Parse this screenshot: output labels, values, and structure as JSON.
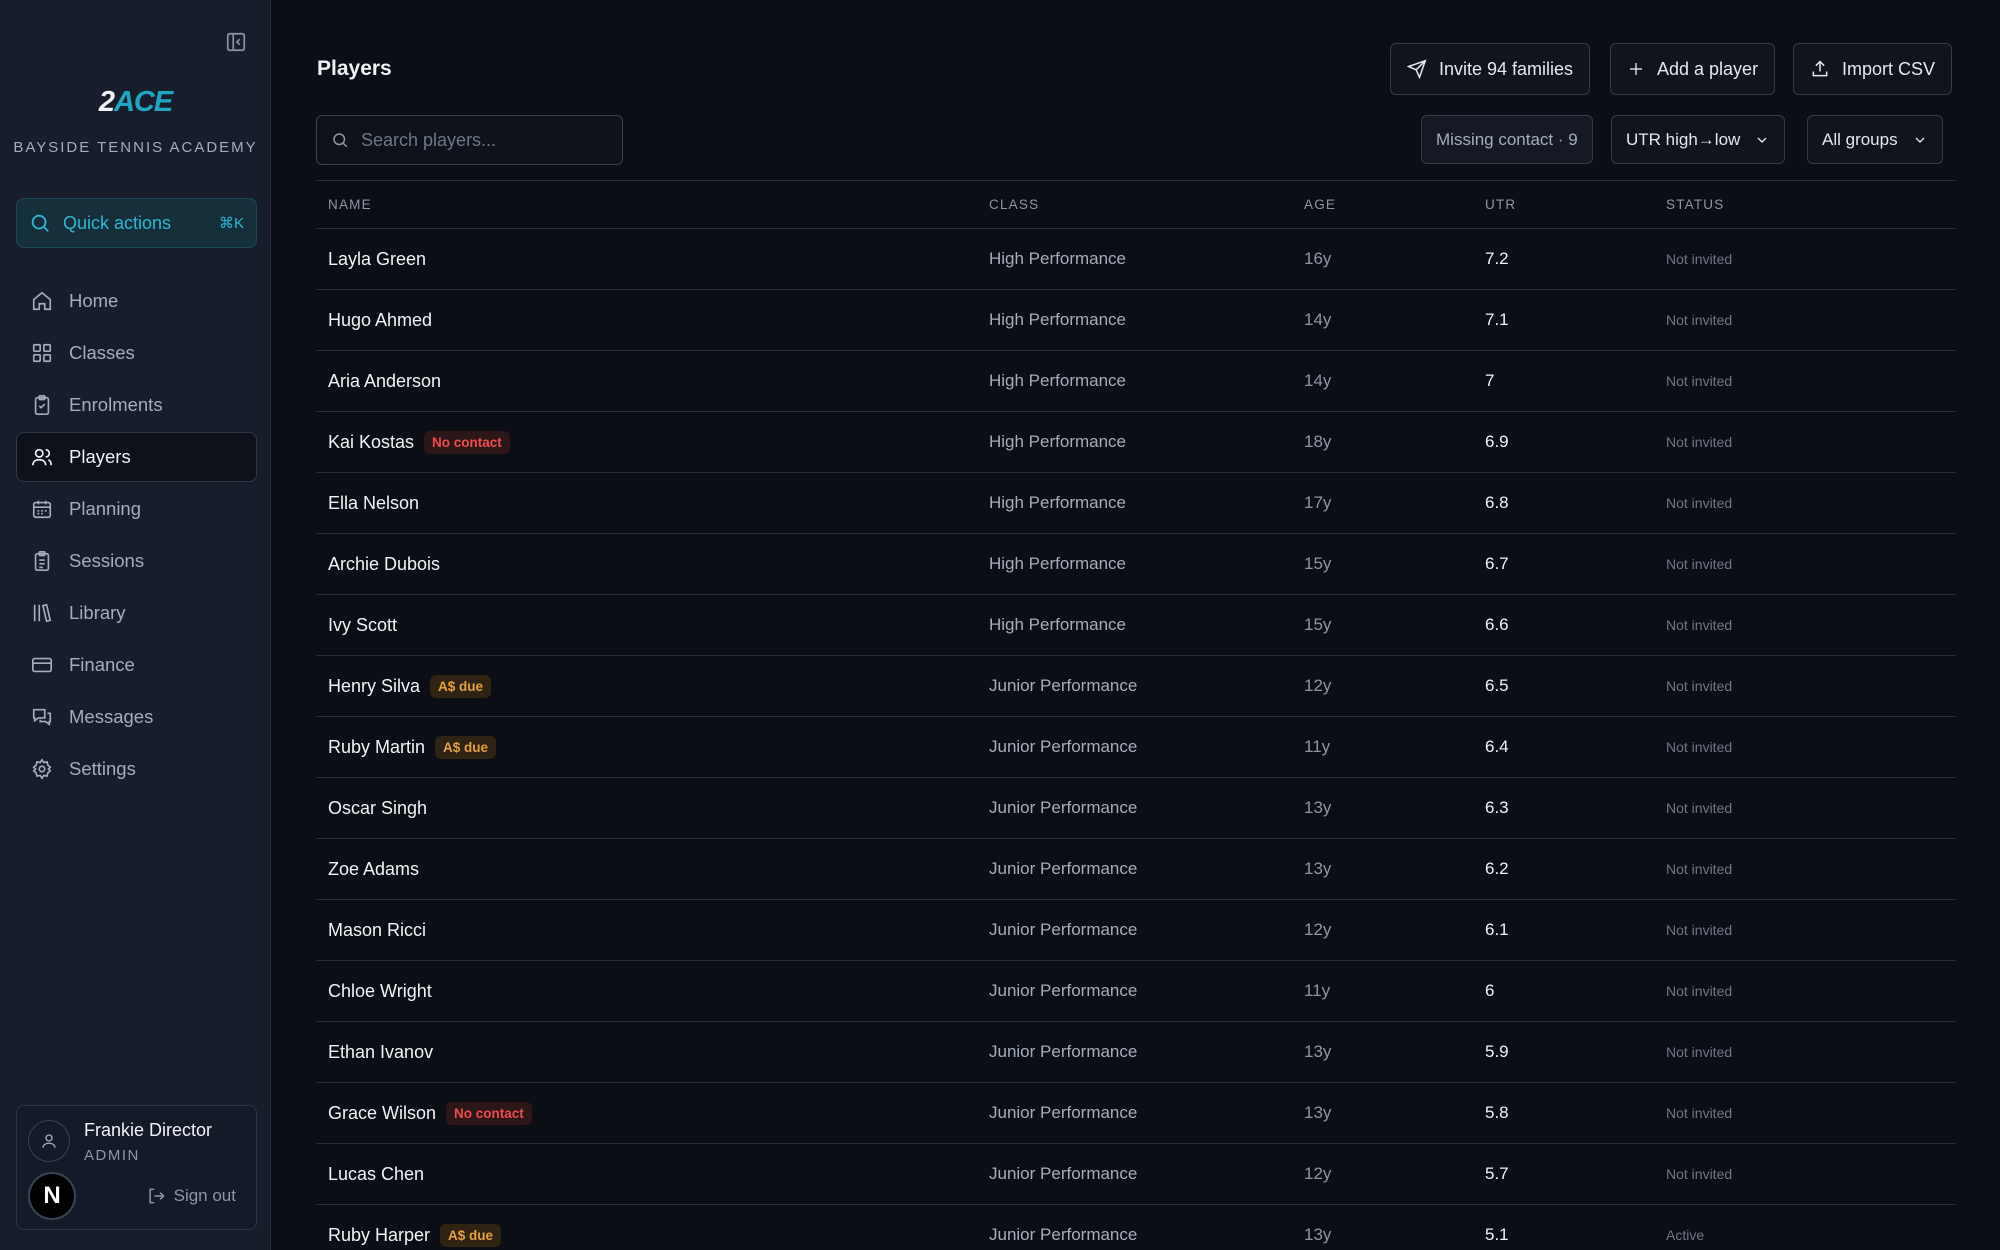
{
  "sidebar": {
    "logo_prefix": "2",
    "logo_suffix": "ACE",
    "academy": "BAYSIDE TENNIS ACADEMY",
    "quick_actions": {
      "label": "Quick actions",
      "shortcut": "⌘K"
    },
    "items": [
      {
        "label": "Home",
        "icon": "home-icon"
      },
      {
        "label": "Classes",
        "icon": "grid-icon"
      },
      {
        "label": "Enrolments",
        "icon": "clipboard-check-icon"
      },
      {
        "label": "Players",
        "icon": "users-icon",
        "active": true
      },
      {
        "label": "Planning",
        "icon": "calendar-icon"
      },
      {
        "label": "Sessions",
        "icon": "clipboard-list-icon"
      },
      {
        "label": "Library",
        "icon": "library-icon"
      },
      {
        "label": "Finance",
        "icon": "credit-card-icon"
      },
      {
        "label": "Messages",
        "icon": "messages-icon"
      },
      {
        "label": "Settings",
        "icon": "gear-icon"
      }
    ],
    "user": {
      "name": "Frankie Director",
      "role": "ADMIN",
      "initial": "N",
      "sign_out": "Sign out"
    }
  },
  "main": {
    "title": "Players",
    "actions": {
      "invite": "Invite 94 families",
      "add": "Add a player",
      "import": "Import CSV"
    },
    "search": {
      "placeholder": "Search players..."
    },
    "filters": {
      "missing": "Missing contact · 9",
      "sort": "UTR high→low",
      "groups": "All groups"
    },
    "columns": [
      "NAME",
      "CLASS",
      "AGE",
      "UTR",
      "STATUS"
    ],
    "rows": [
      {
        "name": "Layla Green",
        "badge": "",
        "badge_type": "",
        "class": "High Performance",
        "age": "16y",
        "utr": "7.2",
        "status": "Not invited"
      },
      {
        "name": "Hugo Ahmed",
        "badge": "",
        "badge_type": "",
        "class": "High Performance",
        "age": "14y",
        "utr": "7.1",
        "status": "Not invited"
      },
      {
        "name": "Aria Anderson",
        "badge": "",
        "badge_type": "",
        "class": "High Performance",
        "age": "14y",
        "utr": "7",
        "status": "Not invited"
      },
      {
        "name": "Kai Kostas",
        "badge": "No contact",
        "badge_type": "no-contact",
        "class": "High Performance",
        "age": "18y",
        "utr": "6.9",
        "status": "Not invited"
      },
      {
        "name": "Ella Nelson",
        "badge": "",
        "badge_type": "",
        "class": "High Performance",
        "age": "17y",
        "utr": "6.8",
        "status": "Not invited"
      },
      {
        "name": "Archie Dubois",
        "badge": "",
        "badge_type": "",
        "class": "High Performance",
        "age": "15y",
        "utr": "6.7",
        "status": "Not invited"
      },
      {
        "name": "Ivy Scott",
        "badge": "",
        "badge_type": "",
        "class": "High Performance",
        "age": "15y",
        "utr": "6.6",
        "status": "Not invited"
      },
      {
        "name": "Henry Silva",
        "badge": "A$ due",
        "badge_type": "due",
        "class": "Junior Performance",
        "age": "12y",
        "utr": "6.5",
        "status": "Not invited"
      },
      {
        "name": "Ruby Martin",
        "badge": "A$ due",
        "badge_type": "due",
        "class": "Junior Performance",
        "age": "11y",
        "utr": "6.4",
        "status": "Not invited"
      },
      {
        "name": "Oscar Singh",
        "badge": "",
        "badge_type": "",
        "class": "Junior Performance",
        "age": "13y",
        "utr": "6.3",
        "status": "Not invited"
      },
      {
        "name": "Zoe Adams",
        "badge": "",
        "badge_type": "",
        "class": "Junior Performance",
        "age": "13y",
        "utr": "6.2",
        "status": "Not invited"
      },
      {
        "name": "Mason Ricci",
        "badge": "",
        "badge_type": "",
        "class": "Junior Performance",
        "age": "12y",
        "utr": "6.1",
        "status": "Not invited"
      },
      {
        "name": "Chloe Wright",
        "badge": "",
        "badge_type": "",
        "class": "Junior Performance",
        "age": "11y",
        "utr": "6",
        "status": "Not invited"
      },
      {
        "name": "Ethan Ivanov",
        "badge": "",
        "badge_type": "",
        "class": "Junior Performance",
        "age": "13y",
        "utr": "5.9",
        "status": "Not invited"
      },
      {
        "name": "Grace Wilson",
        "badge": "No contact",
        "badge_type": "no-contact",
        "class": "Junior Performance",
        "age": "13y",
        "utr": "5.8",
        "status": "Not invited"
      },
      {
        "name": "Lucas Chen",
        "badge": "",
        "badge_type": "",
        "class": "Junior Performance",
        "age": "12y",
        "utr": "5.7",
        "status": "Not invited"
      },
      {
        "name": "Ruby Harper",
        "badge": "A$ due",
        "badge_type": "due",
        "class": "Junior Performance",
        "age": "13y",
        "utr": "5.1",
        "status": "Active"
      }
    ]
  },
  "colors": {
    "accent": "#1fa7c2",
    "danger": "#ee4d4d",
    "warning": "#e6a23c",
    "background": "#0b0e15",
    "sidebar": "#171d2b"
  }
}
